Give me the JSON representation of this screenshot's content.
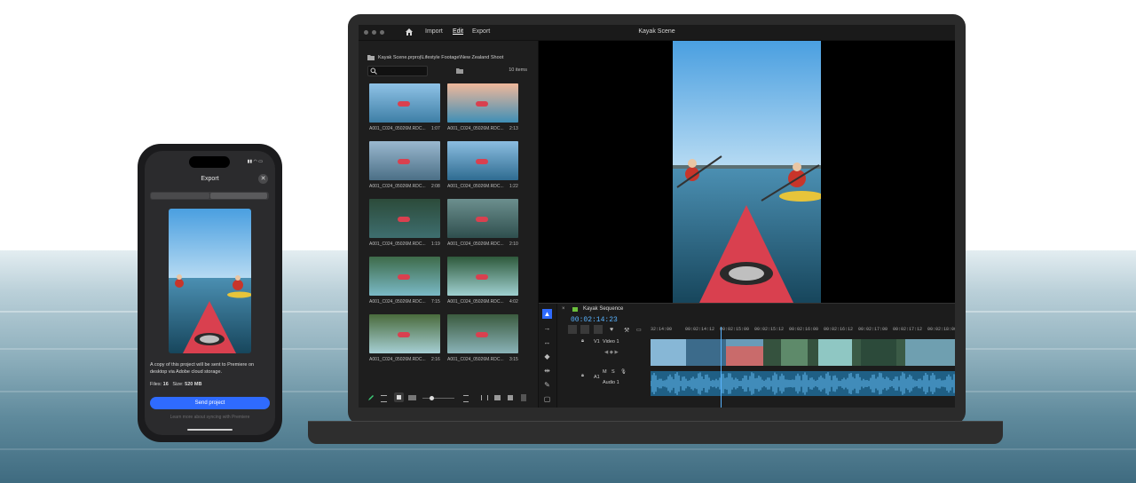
{
  "laptop": {
    "window_title": "Kayak Scene",
    "menu": {
      "import": "Import",
      "edit": "Edit",
      "export": "Export"
    },
    "project_path": "Kayak Scene.prproj\\Lifestyle Footage\\New Zealand Shoot",
    "item_count": "10 items",
    "clips": [
      {
        "name": "A001_C024_05026M.RDC...",
        "duration": "1:07"
      },
      {
        "name": "A001_C024_05026M.RDC...",
        "duration": "2:13"
      },
      {
        "name": "A001_C024_05026M.RDC...",
        "duration": "2:08"
      },
      {
        "name": "A001_C024_05026M.RDC...",
        "duration": "1:22"
      },
      {
        "name": "A001_C024_05026M.RDC...",
        "duration": "1:19"
      },
      {
        "name": "A001_C024_05026M.RDC...",
        "duration": "2:10"
      },
      {
        "name": "A001_C024_05026M.RDC...",
        "duration": "7:15"
      },
      {
        "name": "A001_C024_05026M.RDC...",
        "duration": "4:02"
      },
      {
        "name": "A001_C024_05026M.RDC...",
        "duration": "2:16"
      },
      {
        "name": "A001_C024_05026M.RDC...",
        "duration": "3:15"
      }
    ],
    "sequence_name": "Kayak Sequence",
    "timecode": "00:02:14:23",
    "ruler": [
      "32:14:00",
      "00:02:14:12",
      "00:02:15:00",
      "00:02:15:12",
      "00:02:16:00",
      "00:02:16:12",
      "00:02:17:00",
      "00:02:17:12",
      "00:02:18:00"
    ],
    "video_track": {
      "id": "V1",
      "name": "Video 1"
    },
    "audio_track": {
      "id": "A1",
      "name": "Audio 1",
      "m": "M",
      "s": "S"
    }
  },
  "phone": {
    "title": "Export",
    "description": "A copy of this project will be sent to Premiere on desktop via Adobe cloud storage.",
    "files_label": "Files:",
    "files_value": "16",
    "size_label": "Size:",
    "size_value": "520 MB",
    "send_button": "Send project",
    "footnote": "Learn more about syncing with Premiere"
  },
  "colors": {
    "accent": "#2f6bff",
    "timecode": "#59b3ff",
    "kayak": "#d9404f",
    "audio": "#2b8fcf"
  }
}
